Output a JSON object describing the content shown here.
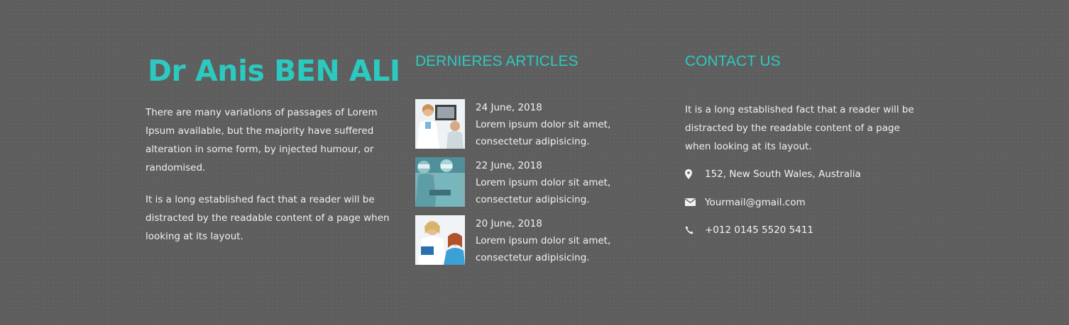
{
  "about": {
    "title": "Dr Anis BEN ALI",
    "paragraph1": "There are many variations of passages of Lorem Ipsum available, but the majority have suffered alteration in some form, by injected humour, or randomised.",
    "paragraph2": "It is a long established fact that a reader will be distracted by the readable content of a page when looking at its layout."
  },
  "articles": {
    "heading": "DERNIERES ARTICLES",
    "items": [
      {
        "date": "24 June, 2018",
        "text": "Lorem ipsum dolor sit amet, consectetur adipisicing."
      },
      {
        "date": "22 June, 2018",
        "text": "Lorem ipsum dolor sit amet, consectetur adipisicing."
      },
      {
        "date": "20 June, 2018",
        "text": "Lorem ipsum dolor sit amet, consectetur adipisicing."
      }
    ]
  },
  "contact": {
    "heading": "CONTACT US",
    "text": "It is a long established fact that a reader will be distracted by the readable content of a page when looking at its layout.",
    "items": [
      {
        "icon": "map-marker-icon",
        "label": "152, New South Wales, Australia"
      },
      {
        "icon": "envelope-icon",
        "label": "Yourmail@gmail.com"
      },
      {
        "icon": "phone-icon",
        "label": "+012 0145 5520 5411"
      }
    ]
  },
  "colors": {
    "accent": "#2cc9c0",
    "background": "#5f5f5f",
    "text": "#f2f2f2"
  }
}
